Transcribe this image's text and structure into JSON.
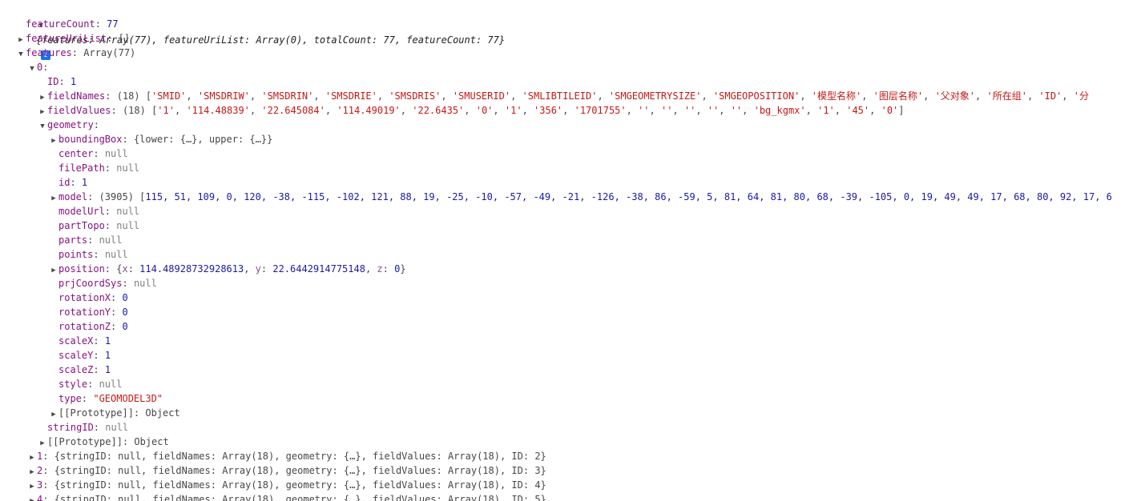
{
  "root": {
    "summary": "{features: Array(77), featureUriList: Array(0), totalCount: 77, featureCount: 77}",
    "info_glyph": "i"
  },
  "rows": [
    {
      "t": "fc",
      "key": "featureCount",
      "sep": ": ",
      "num": "77"
    },
    {
      "t": "fu",
      "key": "featureUriList",
      "sep": ": ",
      "plain": "[]"
    },
    {
      "t": "fe",
      "key": "features",
      "sep": ": ",
      "plain": "Array(77)"
    },
    {
      "t": "i0",
      "key": "0",
      "sep": ":"
    },
    {
      "t": "id",
      "key": "ID",
      "sep": ": ",
      "num": "1"
    },
    {
      "t": "fn",
      "key": "fieldNames",
      "sep": ": ",
      "count": "(18) ",
      "open": "[",
      "items": [
        "'SMID'",
        "'SMSDRIW'",
        "'SMSDRIN'",
        "'SMSDRIE'",
        "'SMSDRIS'",
        "'SMUSERID'",
        "'SMLIBTILEID'",
        "'SMGEOMETRYSIZE'",
        "'SMGEOPOSITION'",
        "'模型名称'",
        "'图层名称'",
        "'父对象'",
        "'所在组'",
        "'ID'",
        "'分"
      ]
    },
    {
      "t": "fv",
      "key": "fieldValues",
      "sep": ": ",
      "count": "(18) ",
      "open": "[",
      "items": [
        "'1'",
        "'114.48839'",
        "'22.645084'",
        "'114.49019'",
        "'22.6435'",
        "'0'",
        "'1'",
        "'356'",
        "'1701755'",
        "''",
        "''",
        "''",
        "''",
        "''",
        "'bg_kgmx'",
        "'1'",
        "'45'",
        "'0'"
      ],
      "close": "]"
    },
    {
      "t": "ge",
      "key": "geometry",
      "sep": ":"
    },
    {
      "t": "bb",
      "key": "boundingBox",
      "sep": ": ",
      "plain": "{lower: {…}, upper: {…}}"
    },
    {
      "t": "ce",
      "key": "center",
      "sep": ": ",
      "nul": "null"
    },
    {
      "t": "fp",
      "key": "filePath",
      "sep": ": ",
      "nul": "null"
    },
    {
      "t": "gi",
      "key": "id",
      "sep": ": ",
      "num": "1"
    },
    {
      "t": "mo",
      "key": "model",
      "sep": ": ",
      "count": "(3905) ",
      "open": "[",
      "nums": "115, 51, 109, 0, 120, -38, -115, -102, 121, 88, 19, -25, -10, -57, -49, -21, -126, -38, 86, -59, 5, 81, 64, 81, 80, 68, -39, -105, 0, 19, 49, 49, 17, 68, 80, 92, 17, 6"
    },
    {
      "t": "mu",
      "key": "modelUrl",
      "sep": ": ",
      "nul": "null"
    },
    {
      "t": "pt",
      "key": "partTopo",
      "sep": ": ",
      "nul": "null"
    },
    {
      "t": "pa",
      "key": "parts",
      "sep": ": ",
      "nul": "null"
    },
    {
      "t": "po",
      "key": "points",
      "sep": ": ",
      "nul": "null"
    },
    {
      "t": "ps",
      "key": "position",
      "sep": ": ",
      "open": "{",
      "pairs": [
        {
          "k": "x",
          "v": "114.48928732928613"
        },
        {
          "k": "y",
          "v": "22.6442914775148"
        },
        {
          "k": "z",
          "v": "0"
        }
      ],
      "close": "}"
    },
    {
      "t": "pc",
      "key": "prjCoordSys",
      "sep": ": ",
      "nul": "null"
    },
    {
      "t": "rx",
      "key": "rotationX",
      "sep": ": ",
      "num": "0"
    },
    {
      "t": "ry",
      "key": "rotationY",
      "sep": ": ",
      "num": "0"
    },
    {
      "t": "rz",
      "key": "rotationZ",
      "sep": ": ",
      "num": "0"
    },
    {
      "t": "sx",
      "key": "scaleX",
      "sep": ": ",
      "num": "1"
    },
    {
      "t": "sy",
      "key": "scaleY",
      "sep": ": ",
      "num": "1"
    },
    {
      "t": "sz",
      "key": "scaleZ",
      "sep": ": ",
      "num": "1"
    },
    {
      "t": "st",
      "key": "style",
      "sep": ": ",
      "nul": "null"
    },
    {
      "t": "ty",
      "key": "type",
      "sep": ": ",
      "str": "\"GEOMODEL3D\""
    },
    {
      "t": "pr1",
      "key": "[[Prototype]]",
      "sep": ": ",
      "plain": "Object"
    },
    {
      "t": "si",
      "key": "stringID",
      "sep": ": ",
      "nul": "null"
    },
    {
      "t": "pr0",
      "key": "[[Prototype]]",
      "sep": ": ",
      "plain": "Object"
    },
    {
      "t": "e1",
      "key": "1",
      "sep": ": ",
      "summary": "{stringID: null, fieldNames: Array(18), geometry: {…}, fieldValues: Array(18), ID: 2}"
    },
    {
      "t": "e2",
      "key": "2",
      "sep": ": ",
      "summary": "{stringID: null, fieldNames: Array(18), geometry: {…}, fieldValues: Array(18), ID: 3}"
    },
    {
      "t": "e3",
      "key": "3",
      "sep": ": ",
      "summary": "{stringID: null, fieldNames: Array(18), geometry: {…}, fieldValues: Array(18), ID: 4}"
    },
    {
      "t": "e4",
      "key": "4",
      "sep": ": ",
      "summary": "{stringID: null, fieldNames: Array(18), geometry: {…}, fieldValues: Array(18), ID: 5}"
    }
  ],
  "icons": {
    "expanded": "expanded-triangle-icon",
    "collapsed": "collapsed-triangle-icon",
    "info": "info-icon"
  },
  "colors": {
    "key": "#881280",
    "number": "#1a1aa6",
    "string": "#c41a16",
    "null": "#808080",
    "info": "#1a73e8"
  }
}
